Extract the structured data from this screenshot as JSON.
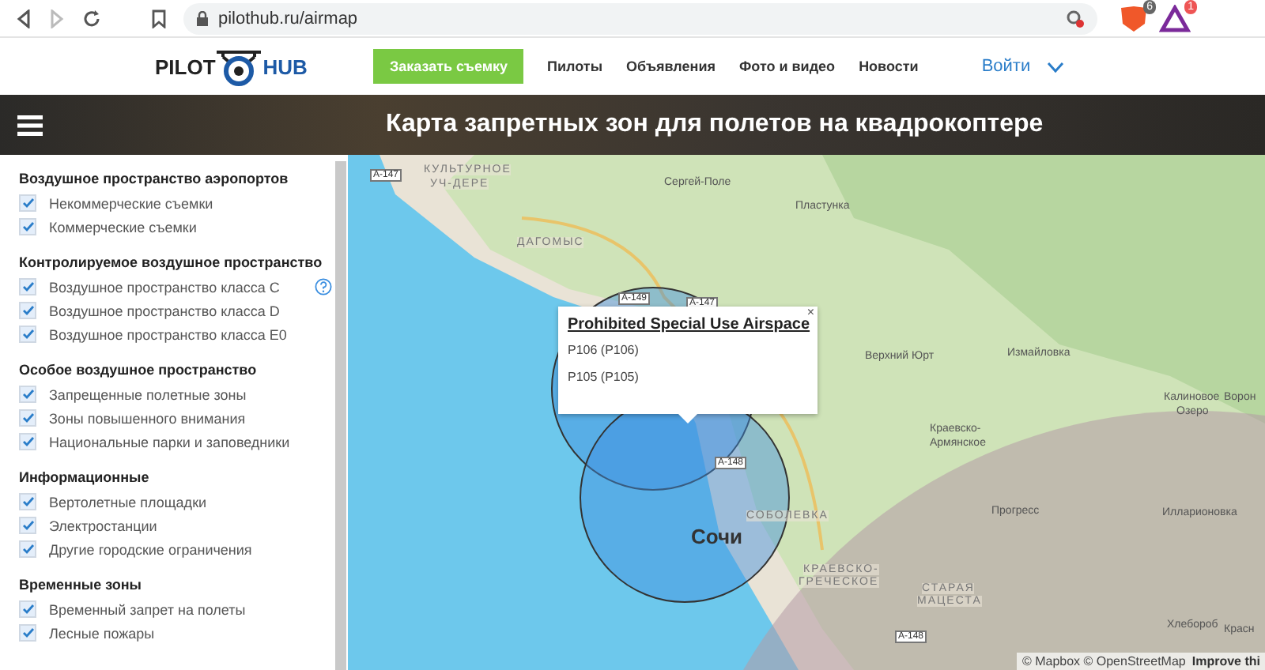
{
  "browser": {
    "url": "pilothub.ru/airmap",
    "badges": [
      "6",
      "1"
    ]
  },
  "header": {
    "logo_left": "PILOT",
    "logo_right": "HUB",
    "order_button": "Заказать съемку",
    "nav": [
      "Пилоты",
      "Объявления",
      "Фото и видео",
      "Новости"
    ],
    "login": "Войти"
  },
  "banner": {
    "title": "Карта запретных зон для полетов на квадрокоптере"
  },
  "sidebar": {
    "groups": [
      {
        "title": "Воздушное пространство аэропортов",
        "items": [
          {
            "label": "Некоммерческие съемки",
            "checked": true
          },
          {
            "label": "Коммерческие съемки",
            "checked": true
          }
        ]
      },
      {
        "title": "Контролируемое воздушное пространство",
        "help": true,
        "items": [
          {
            "label": "Воздушное пространство класса C",
            "checked": true
          },
          {
            "label": "Воздушное пространство класса D",
            "checked": true
          },
          {
            "label": "Воздушное пространство класса E0",
            "checked": true
          }
        ]
      },
      {
        "title": "Особое воздушное пространство",
        "items": [
          {
            "label": "Запрещенные полетные зоны",
            "checked": true
          },
          {
            "label": "Зоны повышенного внимания",
            "checked": true
          },
          {
            "label": "Национальные парки и заповедники",
            "checked": true
          }
        ]
      },
      {
        "title": "Информационные",
        "items": [
          {
            "label": "Вертолетные площадки",
            "checked": true
          },
          {
            "label": "Электростанции",
            "checked": true
          },
          {
            "label": "Другие городские ограничения",
            "checked": true
          }
        ]
      },
      {
        "title": "Временные зоны",
        "items": [
          {
            "label": "Временный запрет на полеты",
            "checked": true
          },
          {
            "label": "Лесные пожары",
            "checked": true
          }
        ]
      }
    ]
  },
  "map": {
    "labels": [
      {
        "text": "КУЛЬТУРНОЕ",
        "kind": "district"
      },
      {
        "text": "УЧ-ДЕРЕ",
        "kind": "district"
      },
      {
        "text": "Сергей-Поле",
        "kind": "place"
      },
      {
        "text": "Пластунка",
        "kind": "place"
      },
      {
        "text": "ДАГОМЫС",
        "kind": "district"
      },
      {
        "text": "Верхний Юрт",
        "kind": "place"
      },
      {
        "text": "Измайловка",
        "kind": "place"
      },
      {
        "text": "Калиновое",
        "kind": "place"
      },
      {
        "text": "Озеро",
        "kind": "place"
      },
      {
        "text": "Ворон",
        "kind": "place"
      },
      {
        "text": "Краевско-",
        "kind": "place"
      },
      {
        "text": "Армянское",
        "kind": "place"
      },
      {
        "text": "СОБОЛЕВКА",
        "kind": "district"
      },
      {
        "text": "Сочи",
        "kind": "city"
      },
      {
        "text": "Прогресс",
        "kind": "place"
      },
      {
        "text": "Илларионовка",
        "kind": "place"
      },
      {
        "text": "КРАЕВСКО-",
        "kind": "district"
      },
      {
        "text": "ГРЕЧЕСКОЕ",
        "kind": "district"
      },
      {
        "text": "СТАРАЯ",
        "kind": "district"
      },
      {
        "text": "МАЦЕСТА",
        "kind": "district"
      },
      {
        "text": "Хлебороб",
        "kind": "place"
      },
      {
        "text": "Красн",
        "kind": "place"
      },
      {
        "text": "А-147",
        "kind": "road"
      },
      {
        "text": "А-149",
        "kind": "road"
      },
      {
        "text": "А-147",
        "kind": "road"
      },
      {
        "text": "А-148",
        "kind": "road"
      },
      {
        "text": "А-148",
        "kind": "road"
      }
    ],
    "popup": {
      "title": "Prohibited Special Use Airspace",
      "lines": [
        "P106 (P106)",
        "P105 (P105)"
      ],
      "close": "×"
    },
    "attribution": {
      "text": "© Mapbox © OpenStreetMap",
      "link": "Improve thi"
    }
  }
}
